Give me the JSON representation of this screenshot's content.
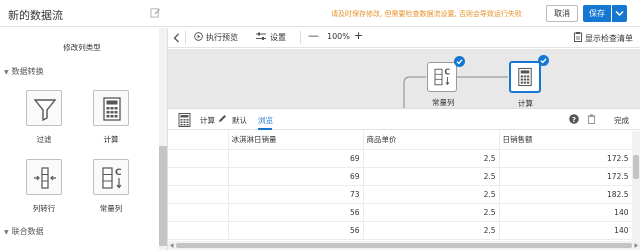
{
  "header": {
    "title": "新的数据流",
    "warning": "请及时保存修改, 但需要检查数据流设置, 否则会导致运行失败",
    "cancel_label": "取消",
    "save_label": "保存"
  },
  "left_panel": {
    "top_tool_label": "修改列类型",
    "section_transform": "数据转换",
    "tools": [
      {
        "label": "过滤",
        "icon": "filter-icon"
      },
      {
        "label": "计算",
        "icon": "calculator-icon"
      },
      {
        "label": "列转行",
        "icon": "column-to-row-icon"
      },
      {
        "label": "常量列",
        "icon": "constant-column-icon"
      }
    ],
    "section_join": "联合数据"
  },
  "toolbar": {
    "run_preview": "执行预览",
    "settings": "设置",
    "zoom": "100%",
    "show_checklist": "显示检查清单"
  },
  "canvas": {
    "nodes": [
      {
        "label": "常量列",
        "icon": "constant-column-icon",
        "status": "complete"
      },
      {
        "label": "计算",
        "icon": "calculator-icon",
        "status": "complete",
        "selected": true
      }
    ]
  },
  "bottom_panel": {
    "tabs": [
      "计算",
      "默认",
      "浏览"
    ],
    "active_tab": "浏览",
    "done_label": "完成"
  },
  "table": {
    "columns": [
      "",
      "冰淇淋日销量",
      "商品单价",
      "日销售额"
    ],
    "rows": [
      [
        "",
        "69",
        "2.5",
        "172.5"
      ],
      [
        "",
        "69",
        "2.5",
        "172.5"
      ],
      [
        "",
        "73",
        "2.5",
        "182.5"
      ],
      [
        "",
        "56",
        "2.5",
        "140"
      ],
      [
        "",
        "56",
        "2.5",
        "140"
      ],
      [
        "",
        "",
        "",
        ""
      ]
    ]
  },
  "colors": {
    "accent": "#1677d2",
    "warning": "#e8902a",
    "canvas_bg": "#e8e8e8"
  }
}
